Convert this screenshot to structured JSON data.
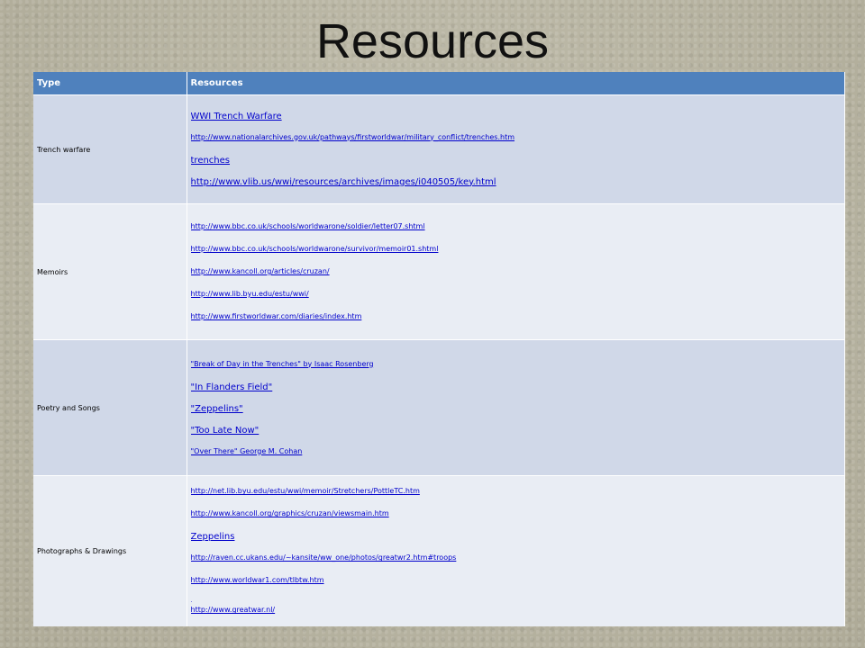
{
  "title": "Resources",
  "headers": {
    "type": "Type",
    "resources": "Resources"
  },
  "rows": [
    {
      "type": "Trench warfare",
      "links": [
        {
          "text": "WWI Trench Warfare",
          "size": "big"
        },
        {
          "text": "http://www.nationalarchives.gov.uk/pathways/firstworldwar/military_conflict/trenches.htm",
          "size": "small"
        },
        {
          "text": "trenches",
          "size": "big"
        },
        {
          "text": "http://www.vlib.us/wwi/resources/archives/images/i040505/key.html",
          "size": "big"
        }
      ]
    },
    {
      "type": "Memoirs",
      "links": [
        {
          "text": "http://www.bbc.co.uk/schools/worldwarone/soldier/letter07.shtml",
          "size": "small"
        },
        {
          "text": "http://www.bbc.co.uk/schools/worldwarone/survivor/memoir01.shtml",
          "size": "small"
        },
        {
          "text": "http://www.kancoll.org/articles/cruzan/",
          "size": "small"
        },
        {
          "text": "http://www.lib.byu.edu/estu/wwi/",
          "size": "small"
        },
        {
          "text": "http://www.firstworldwar.com/diaries/index.htm",
          "size": "small"
        }
      ]
    },
    {
      "type": "Poetry and Songs",
      "links": [
        {
          "text": "\"Break of Day in the Trenches\" by Isaac Rosenberg",
          "size": "small"
        },
        {
          "text": "\"In Flanders Field\"",
          "size": "big"
        },
        {
          "text": "\"Zeppelins\"",
          "size": "big"
        },
        {
          "text": "\"Too Late Now\"",
          "size": "big"
        },
        {
          "text": "\"Over There\"  George M. Cohan",
          "size": "small"
        }
      ]
    },
    {
      "type": "Photographs & Drawings",
      "links": [
        {
          "text": "http://net.lib.byu.edu/estu/wwi/memoir/Stretchers/PottleTC.htm",
          "size": "small"
        },
        {
          "text": "http://www.kancoll.org/graphics/cruzan/viewsmain.htm",
          "size": "small"
        },
        {
          "text": "Zeppelins",
          "size": "big"
        },
        {
          "text": "http://raven.cc.ukans.edu/~kansite/ww_one/photos/greatwr2.htm#troops",
          "size": "small"
        },
        {
          "text": "http://www.worldwar1.com/tlbtw.htm",
          "size": "small"
        },
        {
          "text": ".",
          "size": "dot"
        },
        {
          "text": "http://www.greatwar.nl/",
          "size": "small"
        }
      ]
    }
  ],
  "colors": {
    "header_bg": "#4f81bd",
    "row_odd_bg": "#d0d8e8",
    "row_even_bg": "#e9edf4",
    "link": "#0000cc"
  }
}
